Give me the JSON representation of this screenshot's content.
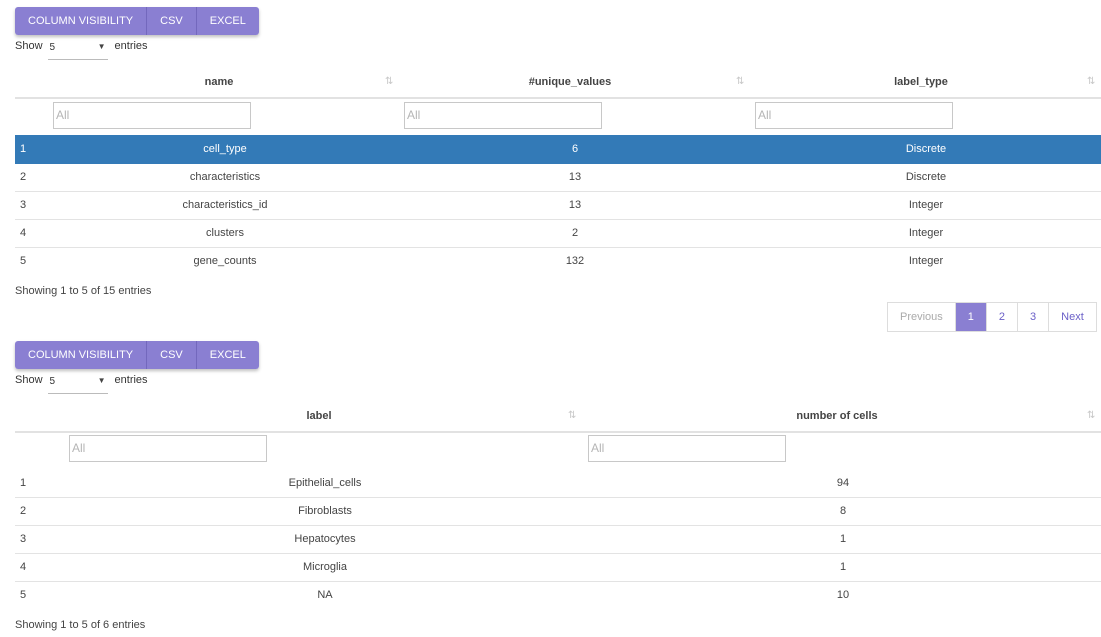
{
  "table1": {
    "buttons": [
      "COLUMN VISIBILITY",
      "CSV",
      "EXCEL"
    ],
    "show_label": "Show",
    "page_size": "5",
    "entries_label": "entries",
    "columns": [
      "name",
      "#unique_values",
      "label_type"
    ],
    "filter_placeholder": "All",
    "rows": [
      {
        "idx": "1",
        "name": "cell_type",
        "unique": "6",
        "type": "Discrete"
      },
      {
        "idx": "2",
        "name": "characteristics",
        "unique": "13",
        "type": "Discrete"
      },
      {
        "idx": "3",
        "name": "characteristics_id",
        "unique": "13",
        "type": "Integer"
      },
      {
        "idx": "4",
        "name": "clusters",
        "unique": "2",
        "type": "Integer"
      },
      {
        "idx": "5",
        "name": "gene_counts",
        "unique": "132",
        "type": "Integer"
      }
    ],
    "info": "Showing 1 to 5 of 15 entries",
    "pagination": [
      "Previous",
      "1",
      "2",
      "3",
      "Next"
    ]
  },
  "table2": {
    "buttons": [
      "COLUMN VISIBILITY",
      "CSV",
      "EXCEL"
    ],
    "show_label": "Show",
    "page_size": "5",
    "entries_label": "entries",
    "columns": [
      "label",
      "number of cells"
    ],
    "filter_placeholder": "All",
    "rows": [
      {
        "idx": "1",
        "label": "Epithelial_cells",
        "count": "94"
      },
      {
        "idx": "2",
        "label": "Fibroblasts",
        "count": "8"
      },
      {
        "idx": "3",
        "label": "Hepatocytes",
        "count": "1"
      },
      {
        "idx": "4",
        "label": "Microglia",
        "count": "1"
      },
      {
        "idx": "5",
        "label": "NA",
        "count": "10"
      }
    ],
    "info": "Showing 1 to 5 of 6 entries"
  },
  "icons": {
    "sort": "sort-arrows-icon",
    "dropdown": "caret-down-icon"
  },
  "colors": {
    "accent": "#8a7fd2",
    "selected_row": "#337ab7"
  }
}
